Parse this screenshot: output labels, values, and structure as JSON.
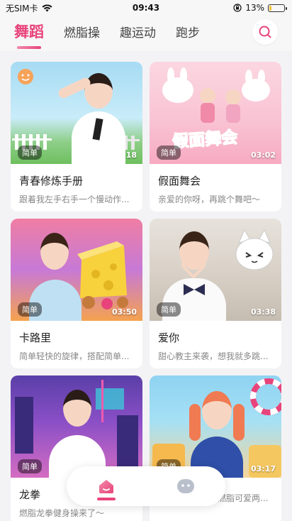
{
  "status_bar": {
    "carrier": "无SIM卡",
    "time": "09:43",
    "battery": "13%",
    "battery_level": 0.13
  },
  "tabs": [
    {
      "label": "舞蹈",
      "active": true
    },
    {
      "label": "燃脂操",
      "active": false
    },
    {
      "label": "趣运动",
      "active": false
    },
    {
      "label": "跑步",
      "active": false
    }
  ],
  "colors": {
    "accent": "#e8447b"
  },
  "cards": [
    {
      "badge": "简单",
      "duration": "18",
      "title": "青春修炼手册",
      "desc": "跟着我左手右手一个慢动作..."
    },
    {
      "badge": "简单",
      "duration": "03:02",
      "title": "假面舞会",
      "desc": "亲爱的你呀，再跳个舞吧～",
      "art_text": "假面舞会"
    },
    {
      "badge": "简单",
      "duration": "03:50",
      "title": "卡路里",
      "desc": "简单轻快的旋律，搭配简单..."
    },
    {
      "badge": "简单",
      "duration": "03:38",
      "title": "爱你",
      "desc": "甜心教主来袭，想我就多跳..."
    },
    {
      "badge": "简单",
      "duration": "",
      "title": "龙拳",
      "desc": "燃脂龙拳健身操来了～"
    },
    {
      "badge": "简单",
      "duration": "03:17",
      "title": "",
      "desc": "甜美增甜屏幕，燃脂可爱两..."
    }
  ],
  "nav": {
    "home_icon": "home-icon",
    "profile_icon": "face-icon"
  }
}
